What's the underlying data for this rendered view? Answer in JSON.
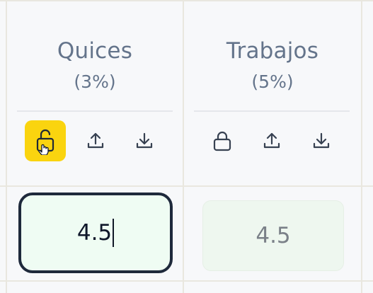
{
  "columns": [
    {
      "title": "Quices",
      "weight": "(3%)",
      "lock_state": "unlocked",
      "grade": "4.5"
    },
    {
      "title": "Trabajos",
      "weight": "(5%)",
      "lock_state": "locked",
      "grade": "4.5"
    }
  ],
  "icons": {
    "unlock": "unlock-icon",
    "lock": "lock-icon",
    "upload": "upload-icon",
    "download": "download-icon"
  },
  "colors": {
    "active_lock_bg": "#fad40f",
    "input_border": "#1e293b",
    "input_bg": "#effcf3",
    "header_text": "#64748b"
  }
}
